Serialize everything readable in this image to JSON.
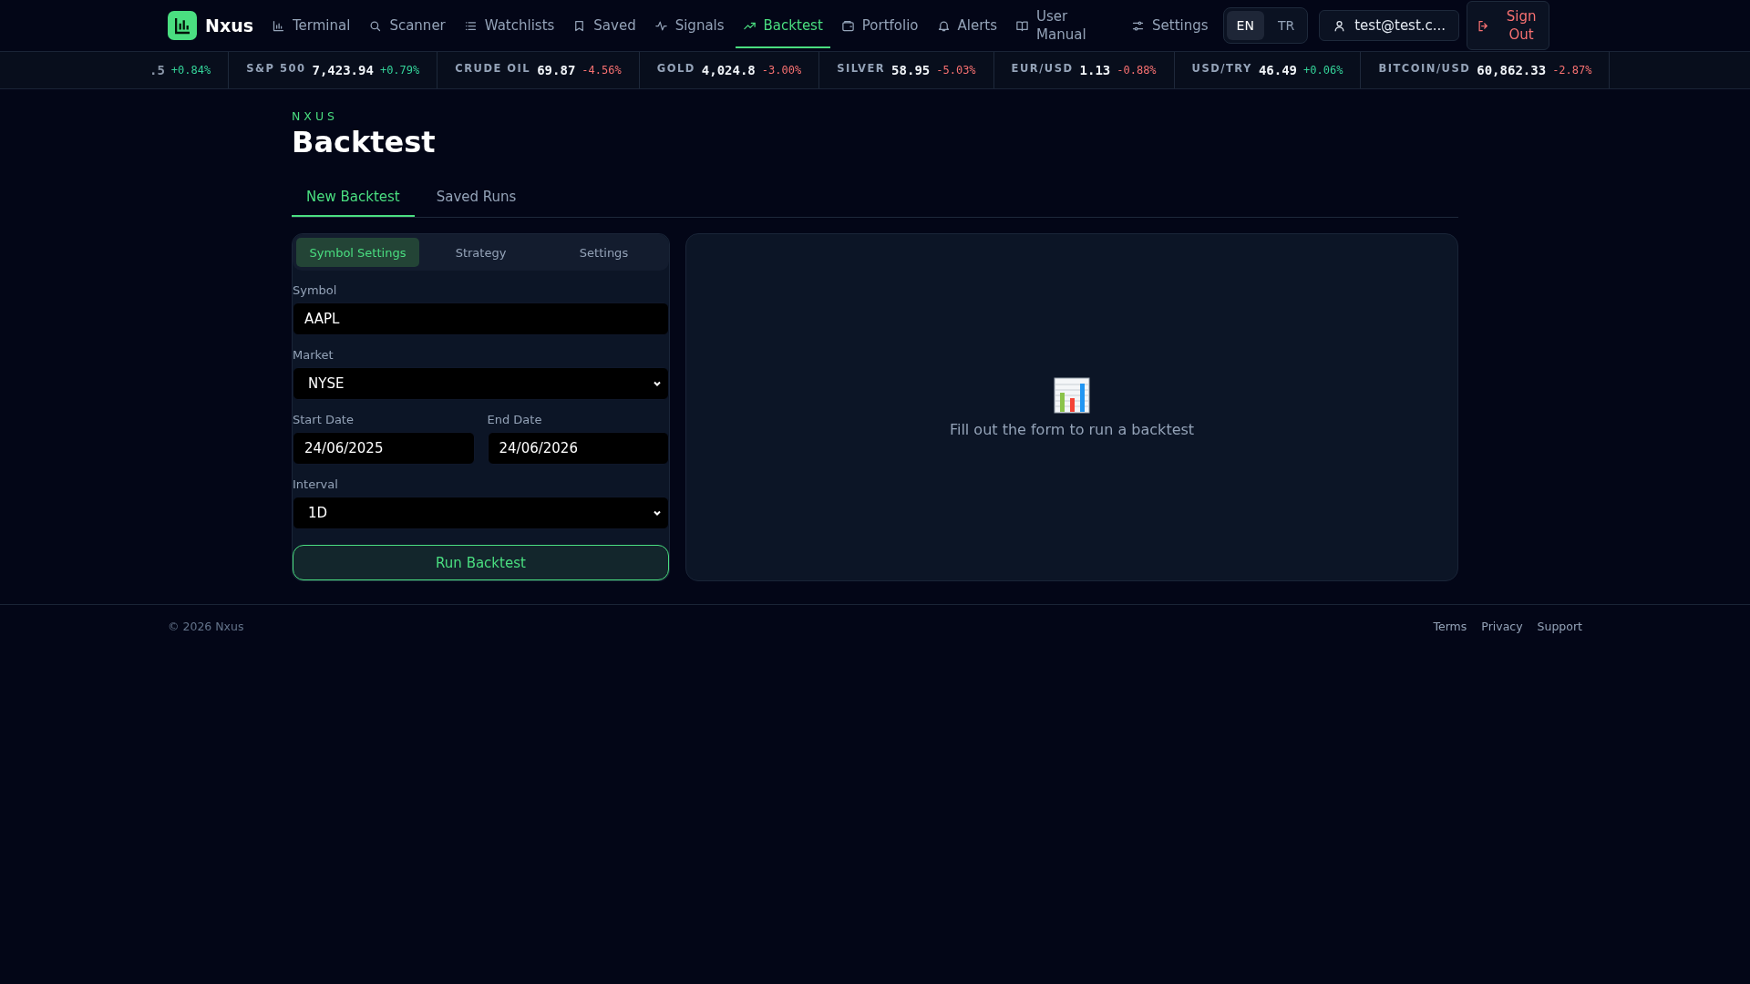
{
  "brand": "Nxus",
  "nav": [
    {
      "label": "Terminal",
      "selected": false
    },
    {
      "label": "Scanner",
      "selected": false
    },
    {
      "label": "Watchlists",
      "selected": false
    },
    {
      "label": "Saved",
      "selected": false
    },
    {
      "label": "Signals",
      "selected": false
    },
    {
      "label": "Backtest",
      "selected": true
    },
    {
      "label": "Portfolio",
      "selected": false
    },
    {
      "label": "Alerts",
      "selected": false
    },
    {
      "label": "User Manual",
      "selected": false
    },
    {
      "label": "Settings",
      "selected": false
    }
  ],
  "languages": [
    {
      "label": "EN",
      "selected": true
    },
    {
      "label": "TR",
      "selected": false
    }
  ],
  "user": "test@test.c...",
  "sign_out": "Sign Out",
  "ticker": [
    {
      "value": ".5",
      "change": "+0.84%",
      "color": "#34d399"
    },
    {
      "label": "S&P 500",
      "value": "7,423.94",
      "change": "+0.79%",
      "color": "#34d399"
    },
    {
      "label": "CRUDE OIL",
      "value": "69.87",
      "change": "-4.56%",
      "color": "#f87171"
    },
    {
      "label": "GOLD",
      "value": "4,024.8",
      "change": "-3.00%",
      "color": "#f87171"
    },
    {
      "label": "SILVER",
      "value": "58.95",
      "change": "-5.03%",
      "color": "#f87171"
    },
    {
      "label": "EUR/USD",
      "value": "1.13",
      "change": "-0.88%",
      "color": "#f87171"
    },
    {
      "label": "USD/TRY",
      "value": "46.49",
      "change": "+0.06%",
      "color": "#34d399"
    },
    {
      "label": "BITCOIN/USD",
      "value": "60,862.33",
      "change": "-2.87%",
      "color": "#f87171"
    }
  ],
  "page": {
    "eyebrow": "NXUS",
    "title": "Backtest"
  },
  "tabs": [
    {
      "label": "New Backtest",
      "selected": true
    },
    {
      "label": "Saved Runs",
      "selected": false
    }
  ],
  "form": {
    "tabs": [
      {
        "label": "Symbol Settings",
        "selected": true
      },
      {
        "label": "Strategy",
        "selected": false
      },
      {
        "label": "Settings",
        "selected": false
      }
    ],
    "rows": [
      [
        {
          "label": "Symbol",
          "kind": "text",
          "value": "AAPL"
        }
      ],
      [
        {
          "label": "Market",
          "kind": "select",
          "value": "NYSE"
        }
      ],
      [
        {
          "label": "Start Date",
          "kind": "text",
          "value": "24/06/2025"
        },
        {
          "label": "End Date",
          "kind": "text",
          "value": "24/06/2026"
        }
      ],
      [
        {
          "label": "Interval",
          "kind": "select",
          "value": "1D"
        }
      ]
    ],
    "submit": "Run Backtest"
  },
  "result": {
    "message": "Fill out the form to run a backtest"
  },
  "footer": {
    "copyright": "© 2026 Nxus",
    "links": [
      "Terms",
      "Privacy",
      "Support"
    ]
  }
}
